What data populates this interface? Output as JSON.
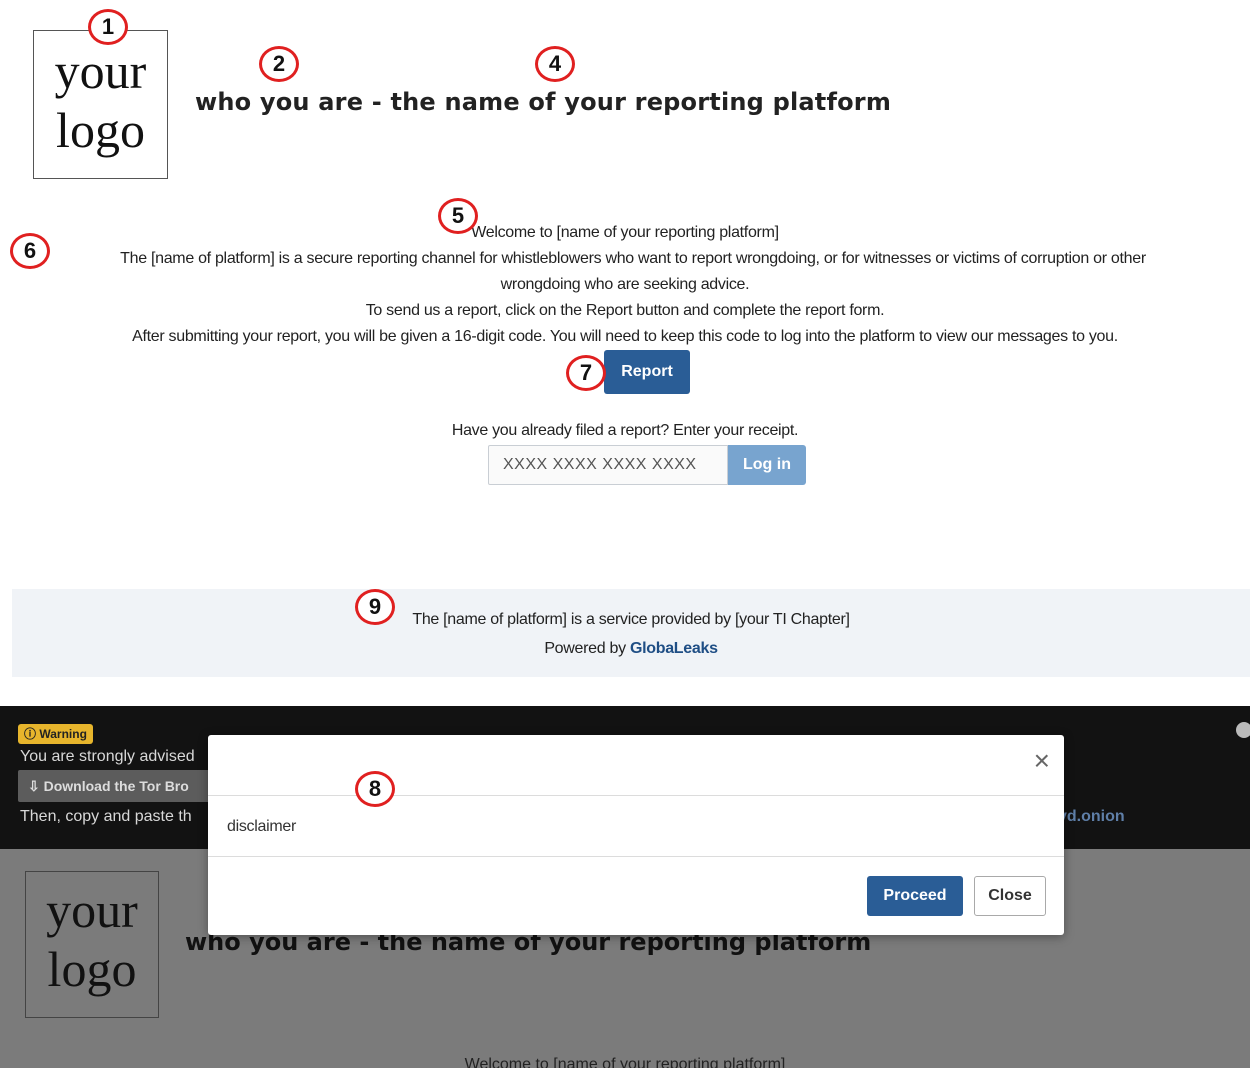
{
  "logo": {
    "line1": "your",
    "line2": "logo"
  },
  "header": {
    "title": "who you are - the name of your reporting platform"
  },
  "welcome": {
    "line1": "Welcome to [name of your reporting platform]",
    "line2": "The [name of platform] is a secure reporting channel for whistleblowers who want to report wrongdoing, or for witnesses or victims of corruption or other",
    "line3": "wrongdoing who are seeking advice.",
    "line4": "To send us a report, click on the Report button and complete the report form.",
    "line5": "After submitting your report, you will be given a 16-digit code. You will need to keep this code to log into the platform to view our messages to you."
  },
  "report_button": {
    "label": "Report"
  },
  "receipt": {
    "prompt": "Have you already filed a report? Enter your receipt.",
    "placeholder": "XXXX XXXX XXXX XXXX",
    "login_label": "Log in"
  },
  "footer": {
    "service_text": "The [name of platform] is a service provided by [your TI Chapter]",
    "powered_prefix": "Powered by",
    "powered_brand": "GlobaLeaks"
  },
  "markers": [
    "1",
    "2",
    "4",
    "5",
    "6",
    "7",
    "9",
    "8"
  ],
  "tor_banner": {
    "badge": "Warning",
    "line1": "You are strongly advised",
    "download_label": "Download the Tor Bro",
    "line3": "Then, copy and paste th",
    "onion_fragment": "yd.onion"
  },
  "modal": {
    "body": "disclaimer",
    "close_glyph": "×",
    "proceed_label": "Proceed",
    "close_label": "Close"
  },
  "colors": {
    "primary": "#2a5d96",
    "login_button": "#78a4cf",
    "footer_bg": "#f0f3f7",
    "marker_ring": "#e02020",
    "warning": "#e7b52c"
  }
}
